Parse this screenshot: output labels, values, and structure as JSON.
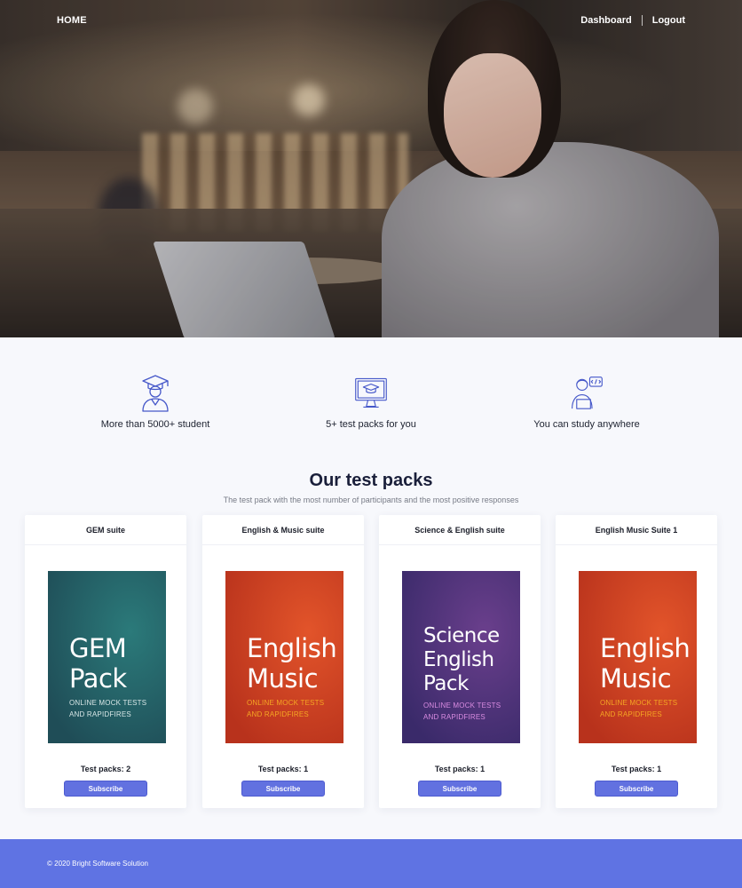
{
  "nav": {
    "home": "HOME",
    "dashboard": "Dashboard",
    "logout": "Logout"
  },
  "features": [
    {
      "icon": "graduate-student-icon",
      "text": "More than 5000+ student"
    },
    {
      "icon": "monitor-graduation-cap-icon",
      "text": "5+ test packs for you"
    },
    {
      "icon": "person-laptop-code-icon",
      "text": "You can study anywhere"
    }
  ],
  "section": {
    "title": "Our test packs",
    "subtitle": "The test pack with the most number of participants and the most positive responses"
  },
  "packs": [
    {
      "name": "GEM suite",
      "cover_lines": [
        "GEM",
        "Pack"
      ],
      "cover_small": [
        "ONLINE MOCK TESTS",
        "AND RAPIDFIRES"
      ],
      "cover_colors": [
        "#1f4d57",
        "#2b7a7a"
      ],
      "cover_small_color": "#d7e6e6",
      "count_text": "Test packs: 2",
      "button": "Subscribe"
    },
    {
      "name": "English & Music suite",
      "cover_lines": [
        "English",
        "Music"
      ],
      "cover_small": [
        "ONLINE MOCK TESTS",
        "AND RAPIDFIRES"
      ],
      "cover_colors": [
        "#b8321c",
        "#e2542a"
      ],
      "cover_small_color": "#f5a623",
      "count_text": "Test packs: 1",
      "button": "Subscribe"
    },
    {
      "name": "Science & English suite",
      "cover_lines": [
        "Science",
        "English",
        "Pack"
      ],
      "cover_small": [
        "ONLINE MOCK TESTS",
        "AND RAPIDFIRES"
      ],
      "cover_colors": [
        "#3a2a6a",
        "#6a3f8c"
      ],
      "cover_small_color": "#d88be0",
      "count_text": "Test packs: 1",
      "button": "Subscribe"
    },
    {
      "name": "English Music Suite 1",
      "cover_lines": [
        "English",
        "Music"
      ],
      "cover_small": [
        "ONLINE MOCK TESTS",
        "AND RAPIDFIRES"
      ],
      "cover_colors": [
        "#b8321c",
        "#e2542a"
      ],
      "cover_small_color": "#f5a623",
      "count_text": "Test packs: 1",
      "button": "Subscribe"
    }
  ],
  "footer": {
    "copyright": "© 2020 Bright Software Solution"
  },
  "colors": {
    "accent": "#5f73e3",
    "button": "#6271e0",
    "icon_stroke": "#4557c9"
  }
}
